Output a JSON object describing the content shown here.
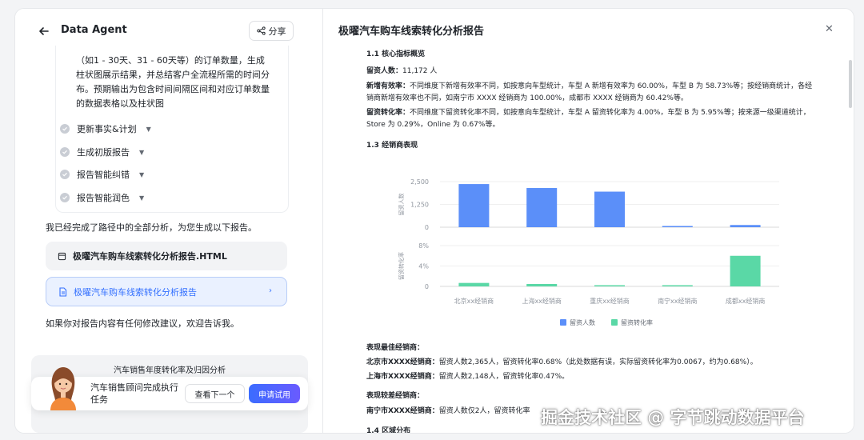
{
  "header": {
    "title": "Data Agent",
    "share_label": "分享"
  },
  "steps": {
    "description": "（如1 - 30天、31 - 60天等）的订单数量，生成柱状图展示结果，并总结客户全流程所需的时间分布。预期输出为包含时间间隔区间和对应订单数量的数据表格以及柱状图",
    "items": [
      {
        "label": "更新事实&计划"
      },
      {
        "label": "生成初版报告"
      },
      {
        "label": "报告智能纠错"
      },
      {
        "label": "报告智能润色"
      }
    ]
  },
  "chat": {
    "done_message": "我已经完成了路径中的全部分析，为您生成以下报告。",
    "file_name": "极曜汽车购车线索转化分析报告.HTML",
    "report_link": "极曜汽车购车线索转化分析报告",
    "feedback": "如果你对报告内容有任何修改建议，欢迎告诉我。"
  },
  "task": {
    "strip_title": "汽车销售年度转化率及归因分析",
    "text": "汽车销售顾问完成执行任务",
    "next_label": "查看下一个",
    "apply_label": "申请试用"
  },
  "report": {
    "title": "极曜汽车购车线索转化分析报告",
    "section_1_1": "1.1 核心指标概览",
    "retention_label": "留资人数：",
    "retention_value": "11,172 人",
    "new_eff_label": "新增有效率：",
    "new_eff_text": "不同维度下新增有效率不同，如按意向车型统计，车型 A 新增有效率为 60.00%，车型 B 为 58.73%等；按经销商统计，各经销商新增有效率也不同，如南宁市 XXXX 经销商为 100.00%，成都市 XXXX 经销商为 60.42%等。",
    "conv_label": "留资转化率：",
    "conv_text": "不同维度下留资转化率不同，如按意向车型统计，车型 A 留资转化率为 4.00%，车型 B 为 5.95%等；按来源一级渠道统计，Store 为 0.29%，Online 为 0.67%等。",
    "section_1_3": "1.3 经销商表现",
    "best_title": "表现最佳经销商：",
    "best_1_name": "北京市XXXX经销商：",
    "best_1_text": "留资人数2,365人，留资转化率0.68%（此处数据有误，实际留资转化率为0.0067，约为0.68%）。",
    "best_2_name": "上海市XXXX经销商：",
    "best_2_text": "留资人数2,148人，留资转化率0.47%。",
    "worse_title": "表现较差经销商：",
    "worse_1_name": "南宁市XXXX经销商：",
    "worse_1_text": "留资人数仅2人，留资转化率",
    "section_1_4": "1.4 区域分布"
  },
  "chart_data": {
    "type": "bar",
    "categories": [
      "北京xx经销商",
      "上海xx经销商",
      "重庆xx经销商",
      "南宁xx经销商",
      "成都xx经销商"
    ],
    "series": [
      {
        "name": "留资人数",
        "values": [
          2365,
          2148,
          1950,
          2,
          120
        ],
        "color": "#5b8ff9"
      },
      {
        "name": "留资转化率",
        "values": [
          0.68,
          0.47,
          0.1,
          0.0,
          6.0
        ],
        "color": "#5ad8a6",
        "unit": "%"
      }
    ],
    "top_ylabel": "留资人数",
    "top_ylim": [
      0,
      2500
    ],
    "top_ticks": [
      "0",
      "1,250",
      "2,500"
    ],
    "bottom_ylabel": "留资转化率",
    "bottom_ylim": [
      0,
      8
    ],
    "bottom_ticks": [
      "0",
      "4%",
      "8%"
    ],
    "legend_position": "bottom"
  },
  "watermark": "掘金技术社区 @ 字节跳动数据平台"
}
